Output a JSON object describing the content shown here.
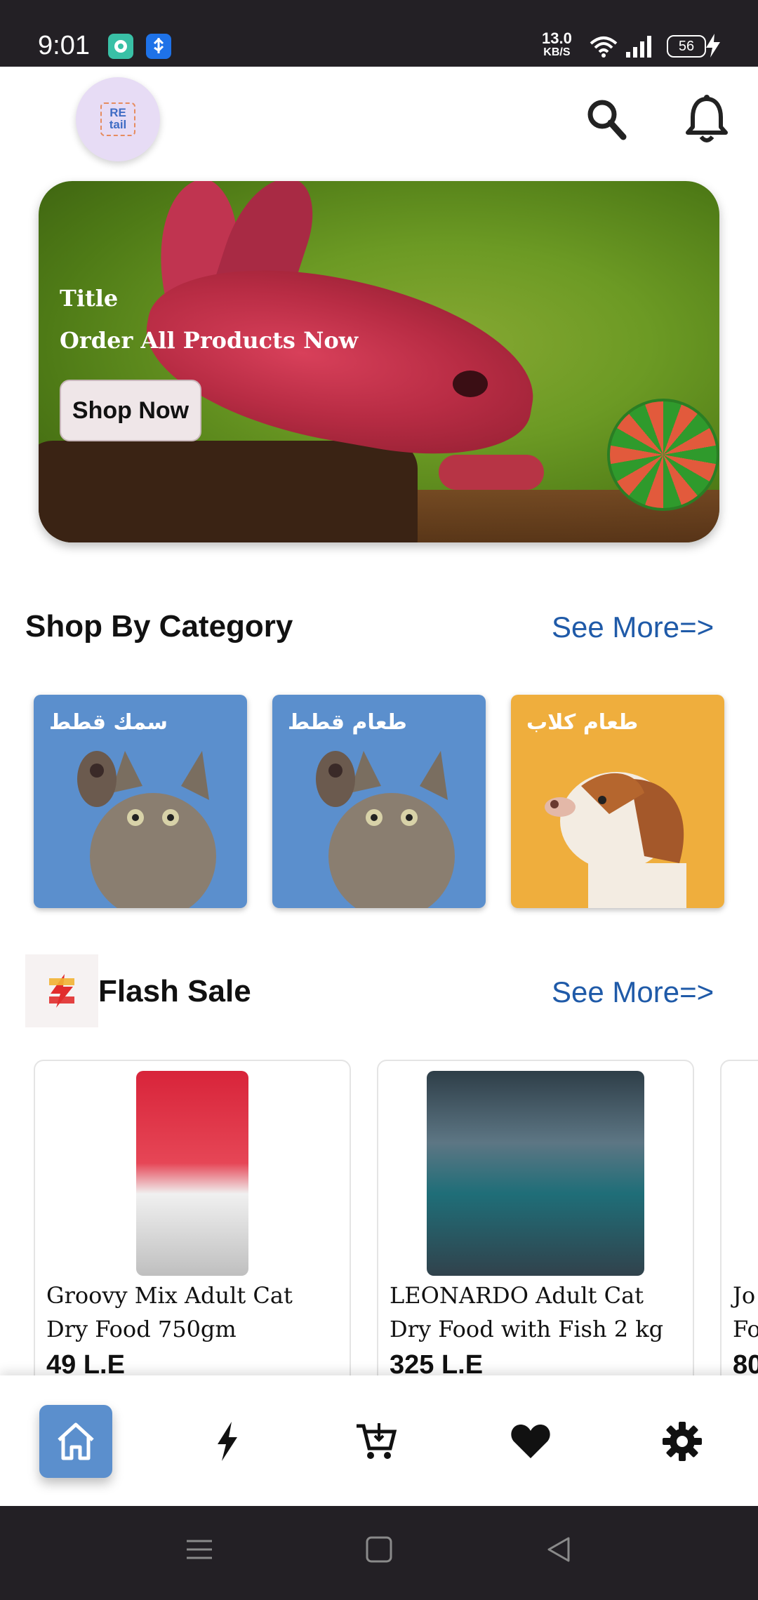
{
  "status_bar": {
    "time": "9:01",
    "speed_value": "13.0",
    "speed_unit": "KB/S",
    "battery": "56"
  },
  "header": {
    "logo_text_top": "RE",
    "logo_text_bottom": "tail",
    "search_icon": "search-icon",
    "notification_icon": "bell-icon"
  },
  "banner": {
    "title": "Title",
    "subtitle": "Order All Products Now",
    "button_label": "Shop Now"
  },
  "categories_section": {
    "title": "Shop By Category",
    "see_more": "See More=>",
    "items": [
      {
        "label": "سمك قطط",
        "color": "#5b8fcd"
      },
      {
        "label": "طعام قطط",
        "color": "#5b8fcd"
      },
      {
        "label": "طعام كلاب",
        "color": "#efae3d"
      }
    ]
  },
  "flash_section": {
    "title": "Flash Sale",
    "see_more": "See More=>",
    "products": [
      {
        "name": "Groovy Mix Adult Cat Dry Food 750gm",
        "price": "49 L.E"
      },
      {
        "name": "LEONARDO Adult Cat Dry Food with Fish 2 kg",
        "price": "325 L.E"
      },
      {
        "name": "Jo Fo",
        "price": "80"
      }
    ]
  },
  "bottom_nav": {
    "items": [
      "home-icon",
      "flash-icon",
      "cart-icon",
      "heart-icon",
      "settings-icon"
    ],
    "active": "home-icon",
    "accent": "#5b8fcd"
  }
}
